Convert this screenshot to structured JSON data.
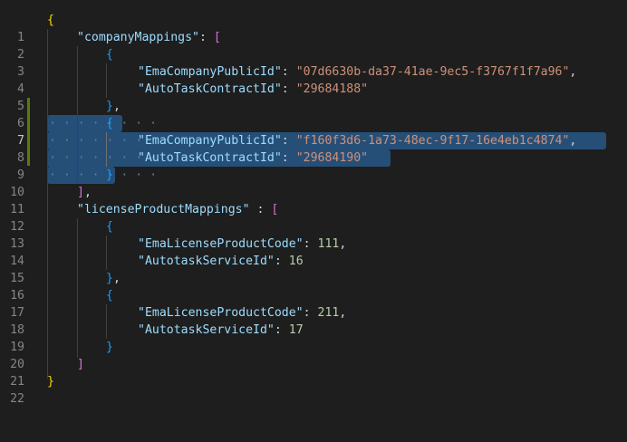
{
  "line_numbers": [
    "1",
    "2",
    "3",
    "4",
    "5",
    "6",
    "7",
    "8",
    "9",
    "10",
    "11",
    "12",
    "13",
    "14",
    "15",
    "16",
    "17",
    "18",
    "19",
    "20",
    "21",
    "22"
  ],
  "active_line": "7",
  "colors": {
    "background": "#1e1e1e",
    "key": "#9cdcfe",
    "string": "#ce9178",
    "number": "#b5cea8",
    "bracket_level1": "#ffd700",
    "bracket_level2": "#da70d6",
    "bracket_level3": "#179fff",
    "selection": "#264f78",
    "git_modified_bar": "#587c0c"
  },
  "code": {
    "open_root": "{",
    "company_key": "\"companyMappings\"",
    "open_company_array": "[",
    "obj1_open": "{",
    "obj1_key1": "\"EmaCompanyPublicId\"",
    "obj1_val1": "\"07d6630b-da37-41ae-9ec5-f3767f1f7a96\"",
    "obj1_key2": "\"AutoTaskContractId\"",
    "obj1_val2": "\"29684188\"",
    "obj1_close": "}",
    "obj2_open": "{",
    "obj2_key1": "\"EmaCompanyPublicId\"",
    "obj2_val1": "\"f160f3d6-1a73-48ec-9f17-16e4eb1c4874\"",
    "obj2_key2": "\"AutoTaskContractId\"",
    "obj2_val2": "\"29684190\"",
    "obj2_close": "}",
    "close_company_array": "]",
    "license_key": "\"licenseProductMappings\"",
    "open_license_array": "[",
    "obj3_open": "{",
    "obj3_key1": "\"EmaLicenseProductCode\"",
    "obj3_val1": "111",
    "obj3_key2": "\"AutotaskServiceId\"",
    "obj3_val2": "16",
    "obj3_close": "}",
    "obj4_open": "{",
    "obj4_key1": "\"EmaLicenseProductCode\"",
    "obj4_val1": "211",
    "obj4_key2": "\"AutotaskServiceId\"",
    "obj4_val2": "17",
    "obj4_close": "}",
    "close_license_array": "]",
    "close_root": "}",
    "colon": ": ",
    "spaced_colon": " : ",
    "comma": ",",
    "space": " "
  }
}
